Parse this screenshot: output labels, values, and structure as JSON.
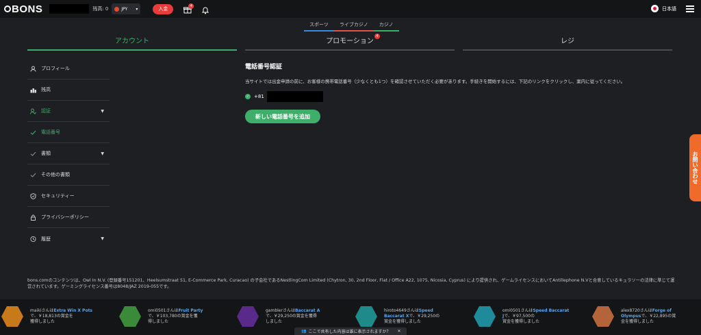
{
  "topbar": {
    "logo": "BONS",
    "balance_label": "残高: 0",
    "currency": "JPY",
    "deposit_label": "入金",
    "gift_badge": "4",
    "language": "日本語"
  },
  "product_tabs": [
    "スポーツ",
    "ライブカジノ",
    "カジノ"
  ],
  "main_tabs": {
    "account": "アカウント",
    "promotion": "プロモーション",
    "promotion_badge": "4",
    "cashier": "レジ"
  },
  "sidebar": {
    "items": [
      {
        "label": "プロフィール",
        "icon": "user-icon"
      },
      {
        "label": "残高",
        "icon": "balance-icon"
      },
      {
        "label": "認証",
        "icon": "verify-icon"
      },
      {
        "label": "電話番号",
        "icon": "check-icon"
      },
      {
        "label": "書類",
        "icon": "check-icon"
      },
      {
        "label": "その他の書類",
        "icon": "check-icon"
      },
      {
        "label": "セキュリティー",
        "icon": "shield-icon"
      },
      {
        "label": "プライバシーポリシー",
        "icon": "lock-icon"
      },
      {
        "label": "履歴",
        "icon": "history-icon"
      }
    ]
  },
  "content": {
    "title": "電話番号認証",
    "description": "当サイトでは出金申請の前に、お客様の携帯電話番号（少なくとも1つ）を確認させていただく必要があります。手続きを開始するには、下記のリンクをクリックし、案内に従ってください。",
    "country_code": "+81",
    "add_button": "新しい電話番号を追加"
  },
  "contact_tab": "お問い合わせ",
  "legal": "bons.comのコンテンツは、Owl In N.V. (登録番号151201、Heelsumstraat 51, E-Commerce Park, Curacao) の子会社であるNestlingCom Limited (Chytron, 30, 2nd Floor, Flat / Office A22, 1075, Nicosia, Cyprus) により提供され、ゲームライセンスにおいてAntillephone N.Vと合意しているキュラソーの法律に準じて運営されています。ゲーミングライセンス番号は8048/JAZ 2019-055です。",
  "winners": [
    {
      "user": "maiki",
      "game": "Extra Win X Pots",
      "amount": "￥18,813の賞金を",
      "tail": "獲得しました",
      "color": "#c87a1a"
    },
    {
      "user": "omi0501",
      "game": "Fruit Party",
      "amount": "￥103,780の賞金を獲",
      "tail": "得しました",
      "color": "#3b8a3a"
    },
    {
      "user": "gambler",
      "game": "Baccarat A",
      "amount": "￥29,250の賞金を獲得",
      "tail": "しました",
      "color": "#5a2a8a"
    },
    {
      "user": "hiroto4649",
      "game": "Speed Baccarat X",
      "amount": "￥29,250の",
      "tail": "賞金を獲得しました",
      "color": "#1f8a8a"
    },
    {
      "user": "omi0501",
      "game": "Speed Baccarat J",
      "amount": "￥97,500の",
      "tail": "賞金を獲得しました",
      "color": "#1f8a9a"
    },
    {
      "user": "alex8720",
      "game": "Forge of Olympus",
      "amount": "￥22,895の賞",
      "tail": "金を獲得しました",
      "color": "#b4643a"
    }
  ],
  "win_connector": "さんは",
  "win_connector2": "で、",
  "cookie_bar": "ここで共有した内容は誰に表示されますか？",
  "colors": {
    "accent_green": "#3fae6a",
    "danger_red": "#e83b3b",
    "contact_orange": "#f06a2a",
    "bg": "#1e1f23"
  }
}
